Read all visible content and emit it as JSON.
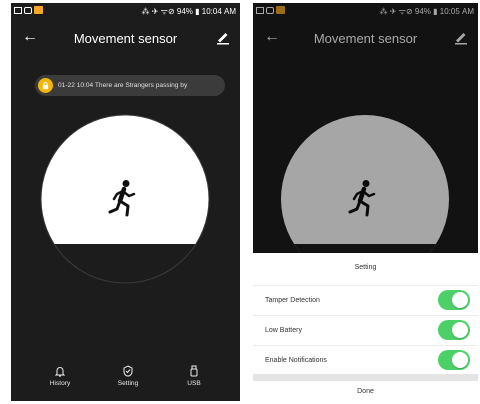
{
  "left_screen": {
    "status": {
      "right_text": "⁂ ✈ ᯤ⊘ 94% ▮ 10:04 AM"
    },
    "title": "Movement sensor",
    "alert": {
      "text": "01-22 10:04 There are Strangers passing by"
    },
    "nav": [
      {
        "label": "History",
        "icon": "bell-icon"
      },
      {
        "label": "Setting",
        "icon": "shield-check-icon"
      },
      {
        "label": "USB",
        "icon": "usb-icon"
      }
    ]
  },
  "right_screen": {
    "status": {
      "right_text": "⁂ ✈ ᯤ⊘ 94% ▮ 10:05 AM"
    },
    "title": "Movement sensor",
    "sheet": {
      "title": "Setting",
      "rows": [
        {
          "label": "Tamper Detection",
          "on": true
        },
        {
          "label": "Low Battery",
          "on": true
        },
        {
          "label": "Enable Notifications",
          "on": true
        }
      ],
      "done_label": "Done"
    }
  },
  "colors": {
    "app_background": "#1c1c1c",
    "alert_icon": "#f2b705",
    "toggle_on": "#4cd068",
    "sensor_circle": "#ffffff"
  }
}
